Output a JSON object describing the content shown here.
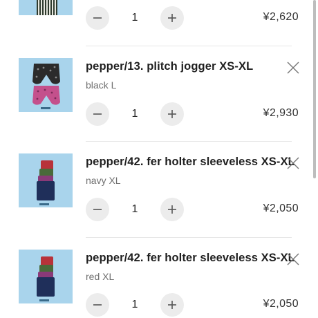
{
  "cart": {
    "items": [
      {
        "title": "",
        "variant": "",
        "quantity": "1",
        "price": "¥2,620",
        "image_icon": "striped-garment-thumbnail",
        "partial": true
      },
      {
        "title": "pepper/13. plitch jogger XS-XL",
        "variant": "black L",
        "quantity": "1",
        "price": "¥2,930",
        "image_icon": "jogger-pants-thumbnail"
      },
      {
        "title": "pepper/42. fer holter sleeveless XS-XL",
        "variant": "navy XL",
        "quantity": "1",
        "price": "¥2,050",
        "image_icon": "sleeveless-tops-thumbnail"
      },
      {
        "title": "pepper/42. fer holter sleeveless XS-XL",
        "variant": "red XL",
        "quantity": "1",
        "price": "¥2,050",
        "image_icon": "sleeveless-tops-thumbnail"
      }
    ],
    "colors": {
      "thumbnail_bg": "#a9d4ec",
      "stepper_bg": "#ececec",
      "divider": "#e6e6e6"
    }
  }
}
